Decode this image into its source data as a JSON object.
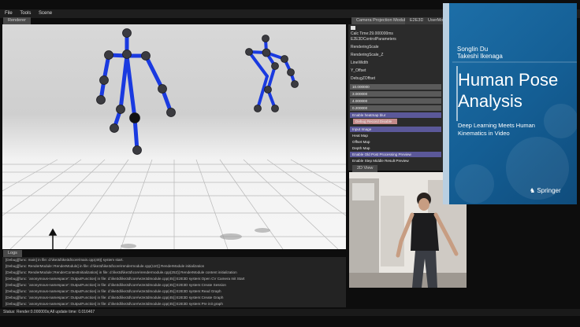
{
  "menu": {
    "file": "File",
    "tools": "Tools",
    "scene": "Scene"
  },
  "tabs": {
    "renderer": "Renderer",
    "camera_projection": "Camera Projection Module",
    "e2e3d": "E2E3D",
    "user_mod": "UserMod",
    "logs": "Logs",
    "view2d": "2D View"
  },
  "params": {
    "calc_time": "Calc Time:29.000000ms",
    "control_params": "E2E3DControlParameters",
    "rendering_scale": "RenderingScale",
    "rendering_scale_z": "RenderingScale_Z",
    "line_width": "LineWidth",
    "y_offset": "Y_Offset",
    "debug_z_offset": "DebugZOffset",
    "values": [
      "10.000000",
      "3.000000",
      "4.000000",
      "0.200000"
    ],
    "enable_heatmap_blur": "Enable heatmap blur",
    "debug_record_disable": "Debug Record Disable",
    "options": [
      "Input Image",
      "Heat Map",
      "Offset Map",
      "Depth Map"
    ],
    "enable_post_processing": "Enable Old Post Processing Preview",
    "enable_step_middle": "Enable Step Middle Result Preview"
  },
  "logs": [
    "[Debug][func: main] in file: d:\\ike3d\\ike3d\\core\\main.cpp(49)] system start.",
    "[Debug][func: RenderModule::RenderModule] in file: d:\\ike3d\\ike3d\\core\\rendermodule.cpp(110)] RenderModule initialization",
    "[Debug][func: RenderModule::RenderContextInitialization] in file: d:\\ike3d\\ike3d\\core\\rendermodule.cpp(252)] RenderModule content initialization",
    "[Debug][func: `anonymous-namespace'::OutputFunction] in file: d:\\ike3d\\ike3d\\core\\e2e3dmodule.cpp(45)] E2E3D system:Open CV Camera Init Start",
    "[Debug][func: `anonymous-namespace'::OutputFunction] in file: d:\\ike3d\\ike3d\\core\\e2e3dmodule.cpp(45)] E2E3D system:Create Session",
    "[Debug][func: `anonymous-namespace'::OutputFunction] in file: d:\\ike3d\\ike3d\\core\\e2e3dmodule.cpp(45)] E2E3D system:Read Graph",
    "[Debug][func: `anonymous-namespace'::OutputFunction] in file: d:\\ike3d\\ike3d\\core\\e2e3dmodule.cpp(45)] E2E3D system:Create Graph",
    "[Debug][func: `anonymous-namespace'::OutputFunction] in file: d:\\ike3d\\ike3d\\core\\e2e3dmodule.cpp(45)] E2E3D system:Pre init graph"
  ],
  "status": "Status: Render:0.000000s;All update time: 0.016467",
  "book": {
    "author1": "Songlin Du",
    "author2": "Takeshi Ikenaga",
    "title1": "Human Pose",
    "title2": "Analysis",
    "subtitle1": "Deep Learning Meets Human",
    "subtitle2": "Kinematics in Video",
    "publisher": "Springer"
  },
  "colors": {
    "bone": "#1a3ae0",
    "joint": "#3b3b40",
    "panel": "#2b2b2b",
    "highlight": "#5b5899",
    "book_blue": "#1d6fa8"
  }
}
